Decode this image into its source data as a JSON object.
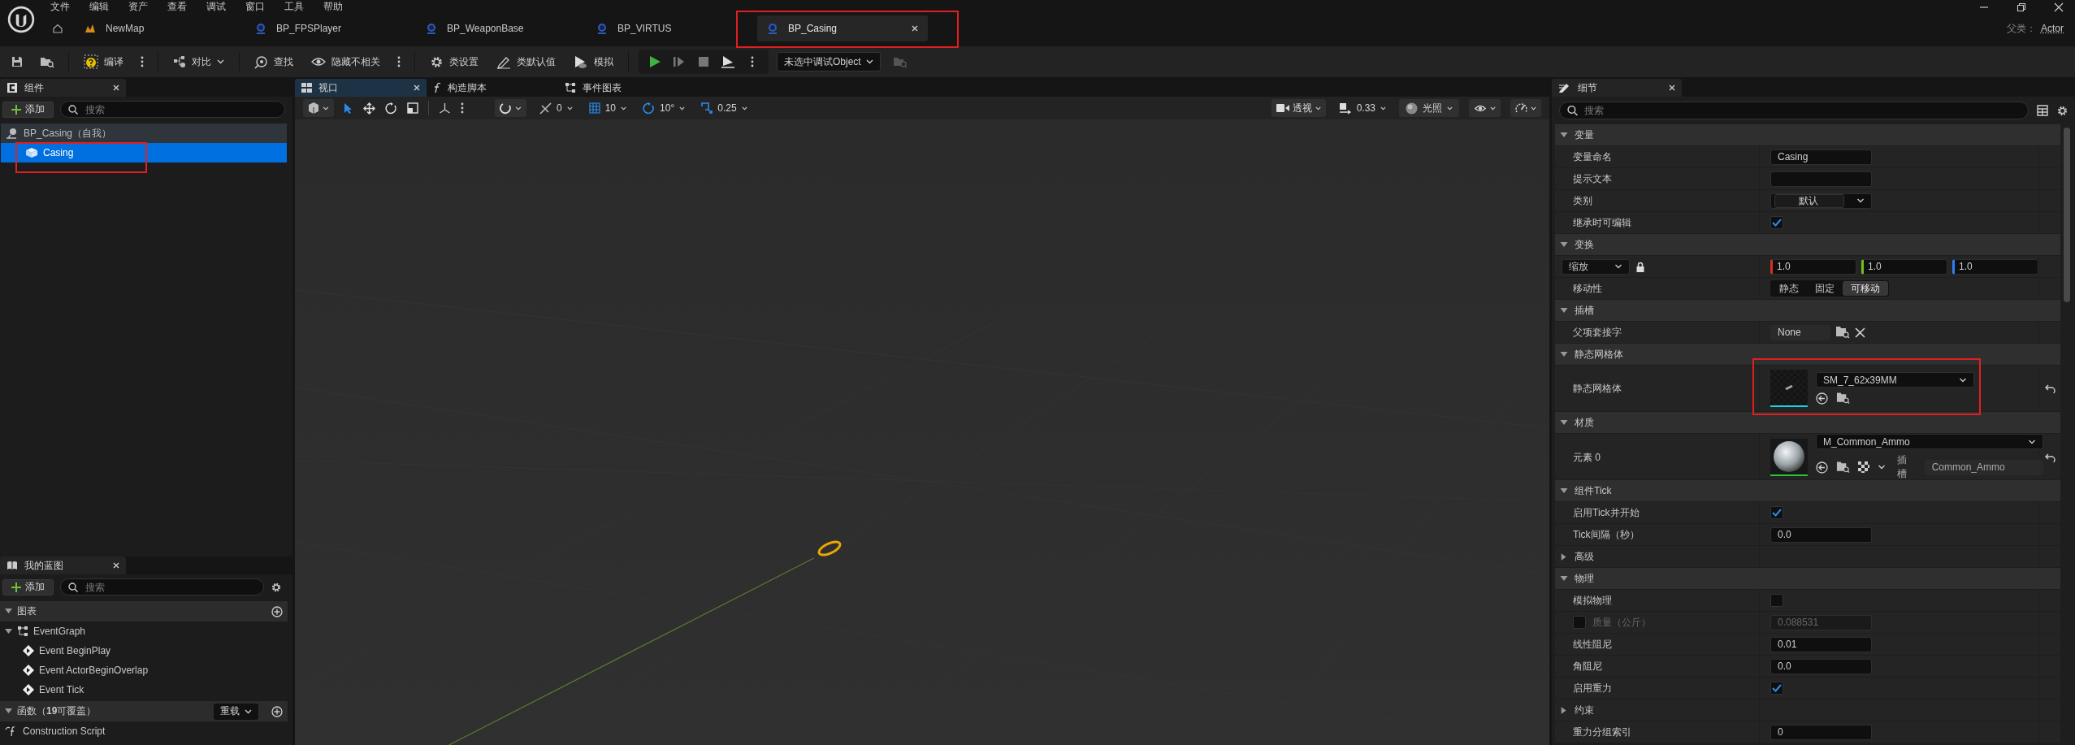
{
  "menu": [
    "文件",
    "编辑",
    "资产",
    "查看",
    "调试",
    "窗口",
    "工具",
    "帮助"
  ],
  "doc_tabs": [
    {
      "label": "NewMap",
      "kind": "map",
      "selected": false,
      "highlighted": false
    },
    {
      "label": "BP_FPSPlayer",
      "kind": "blueprint",
      "selected": false,
      "highlighted": false
    },
    {
      "label": "BP_WeaponBase",
      "kind": "blueprint",
      "selected": false,
      "highlighted": false
    },
    {
      "label": "BP_VIRTUS",
      "kind": "blueprint",
      "selected": false,
      "highlighted": false
    },
    {
      "label": "BP_Casing",
      "kind": "blueprint",
      "selected": true,
      "highlighted": true
    }
  ],
  "parent_class": {
    "label": "父类：",
    "value": "Actor"
  },
  "toolbar": {
    "compile": "编译",
    "diff": "对比",
    "find": "查找",
    "hide_unrelated": "隐藏不相关",
    "class_settings": "类设置",
    "class_defaults": "类默认值",
    "simulate": "模拟",
    "debug_object": "未选中调试Object"
  },
  "components_panel": {
    "title": "组件",
    "add": "添加",
    "search_placeholder": "搜索",
    "tree": [
      {
        "label": "BP_Casing（自我）",
        "selected": false,
        "highlighted": false,
        "children": [
          {
            "label": "Casing",
            "selected": true,
            "highlighted": true
          }
        ]
      }
    ]
  },
  "my_blueprint": {
    "title": "我的蓝图",
    "add": "添加",
    "search_placeholder": "搜索",
    "sections": [
      {
        "label": "图表",
        "expanded": true,
        "items": [
          {
            "label": "EventGraph",
            "kind": "graph",
            "expanded": true,
            "children": [
              {
                "label": "Event BeginPlay",
                "kind": "event"
              },
              {
                "label": "Event ActorBeginOverlap",
                "kind": "event"
              },
              {
                "label": "Event Tick",
                "kind": "event"
              }
            ]
          }
        ]
      },
      {
        "label": "函数（**19**可覆盖）",
        "expanded": true,
        "override": "重载",
        "items": [
          {
            "label": "Construction Script",
            "kind": "function"
          }
        ]
      }
    ]
  },
  "editor_tabs": [
    {
      "label": "视口",
      "kind": "viewport",
      "selected": true
    },
    {
      "label": "构造脚本",
      "kind": "script",
      "selected": false
    },
    {
      "label": "事件图表",
      "kind": "graph",
      "selected": false
    }
  ],
  "viewport_toolbar": {
    "surface_snap": "0",
    "grid_snap": "10",
    "rotation_snap": "10°",
    "scale_snap": "0.25",
    "view_mode": "透视",
    "camera_speed": "0.33",
    "lighting": "光照"
  },
  "details": {
    "title": "细节",
    "search_placeholder": "搜索",
    "items": [
      {
        "kind": "section",
        "label": "变量",
        "expanded": true
      },
      {
        "kind": "text",
        "label": "变量命名",
        "value": "Casing"
      },
      {
        "kind": "text",
        "label": "提示文本"
      },
      {
        "kind": "dropdown",
        "label": "类别",
        "value": "默认"
      },
      {
        "kind": "checkbox",
        "label": "继承时可编辑",
        "checked": true
      },
      {
        "kind": "section",
        "label": "变换",
        "expanded": true
      },
      {
        "kind": "vector",
        "mode": "缩放",
        "values": [
          "1.0",
          "1.0",
          "1.0"
        ]
      },
      {
        "kind": "segmented",
        "label": "移动性",
        "options": [
          {
            "label": "静态",
            "selected": false
          },
          {
            "label": "固定",
            "selected": false
          },
          {
            "label": "可移动",
            "selected": true
          }
        ]
      },
      {
        "kind": "section",
        "label": "插槽",
        "expanded": true
      },
      {
        "kind": "socket",
        "label": "父项套接字",
        "value": "None"
      },
      {
        "kind": "section",
        "label": "静态网格体",
        "expanded": true
      },
      {
        "kind": "asset",
        "label": "静态网格体",
        "value": "SM_7_62x39MM",
        "highlighted": true
      },
      {
        "kind": "section",
        "label": "材质",
        "expanded": true
      },
      {
        "kind": "material",
        "label": "元素 0",
        "value": "M_Common_Ammo",
        "slot_label": "插槽",
        "slot": "Common_Ammo"
      },
      {
        "kind": "section",
        "label": "组件Tick",
        "expanded": true
      },
      {
        "kind": "checkbox",
        "label": "启用Tick并开始",
        "checked": true
      },
      {
        "kind": "number",
        "label": "Tick间隔（秒）",
        "value": "0.0",
        "disabled": false
      },
      {
        "kind": "subsection",
        "label": "高级",
        "expanded": false
      },
      {
        "kind": "section",
        "label": "物理",
        "expanded": true
      },
      {
        "kind": "checkbox",
        "label": "模拟物理",
        "checked": false
      },
      {
        "kind": "number",
        "label": "质量（公斤）",
        "value": "0.088531",
        "disabled": true,
        "checked": false
      },
      {
        "kind": "number",
        "label": "线性阻尼",
        "value": "0.01",
        "disabled": false
      },
      {
        "kind": "number",
        "label": "角阻尼",
        "value": "0.0",
        "disabled": false
      },
      {
        "kind": "checkbox",
        "label": "启用重力",
        "checked": true
      },
      {
        "kind": "subsection",
        "label": "约束",
        "expanded": false
      },
      {
        "kind": "number",
        "label": "重力分组索引",
        "value": "0",
        "disabled": false
      }
    ]
  }
}
